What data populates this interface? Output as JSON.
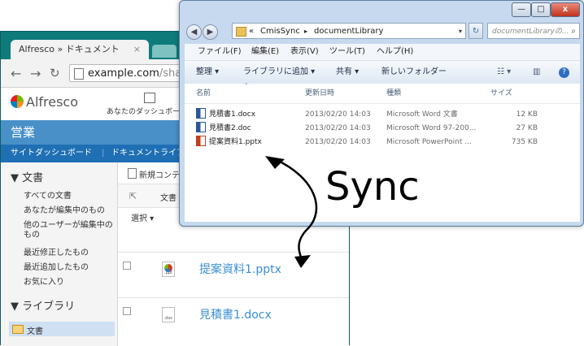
{
  "browser": {
    "tab_title": "Alfresco » ドキュメント",
    "tab_close": "×",
    "url_host": "example.com",
    "url_path": "/share/",
    "nav_back": "←",
    "nav_forward": "→"
  },
  "alfresco": {
    "logo_text": "Alfresco",
    "dashboard_label": "あなたのダッシュボード",
    "site_name": "営業",
    "site_nav": [
      "サイトダッシュボード",
      "ドキュメントライブラ"
    ],
    "sidebar": {
      "documents_heading": "▼ 文書",
      "document_filters": [
        "すべての文書",
        "あなたが編集中のもの",
        "他のユーザーが編集中の",
        "もの",
        "最近修正したもの",
        "最近追加したもの",
        "お気に入り"
      ],
      "library_heading": "▼ ライブラリ",
      "library_folder": "文書"
    },
    "toolbar": {
      "new_content": "新規コンテ",
      "docs_label": "文書",
      "select_label": "選択 ▾"
    },
    "documents": [
      {
        "name": "提案資料1.pptx",
        "ext": ".ppt"
      },
      {
        "name": "見積書1.docx",
        "ext": ".doc"
      }
    ]
  },
  "explorer": {
    "window_buttons": {
      "minimize": "—",
      "maximize": "□",
      "close": "x"
    },
    "breadcrumb": [
      "«",
      "CmisSync",
      "▸",
      "documentLibrary"
    ],
    "search_placeholder": "documentLibraryの...",
    "menu": [
      "ファイル(F)",
      "編集(E)",
      "表示(V)",
      "ツール(T)",
      "ヘルプ(H)"
    ],
    "commands": [
      "整理 ▾",
      "ライブラリに追加 ▾",
      "共有 ▾",
      "新しいフォルダー"
    ],
    "columns": [
      "名前",
      "更新日時",
      "種類",
      "サイズ"
    ],
    "files": [
      {
        "name": "見積書1.docx",
        "modified": "2013/02/20 14:03",
        "type": "Microsoft Word 文書",
        "size": "12 KB",
        "icon": "word"
      },
      {
        "name": "見積書2.doc",
        "modified": "2013/02/20 14:03",
        "type": "Microsoft Word 97-200...",
        "size": "27 KB",
        "icon": "word"
      },
      {
        "name": "提案資料1.pptx",
        "modified": "2013/02/20 14:03",
        "type": "Microsoft PowerPoint ...",
        "size": "735 KB",
        "icon": "powerpoint"
      }
    ]
  },
  "annotation": {
    "sync_label": "Sync"
  }
}
